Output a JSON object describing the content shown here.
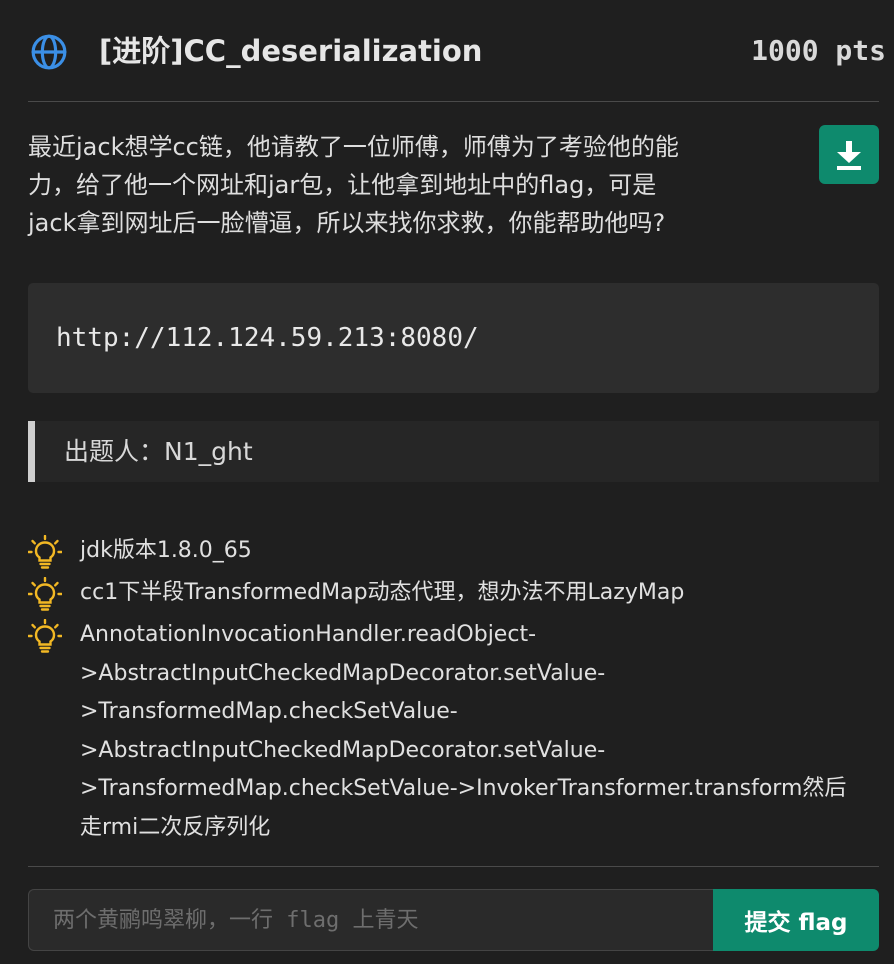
{
  "challenge": {
    "title": "[进阶]CC_deserialization",
    "points": "1000 pts",
    "description_lines": [
      "最近jack想学cc链，他请教了一位师傅，师傅为了考验他的能",
      "力，给了他一个网址和jar包，让他拿到地址中的flag，可是",
      "jack拿到网址后一脸懵逼，所以来找你求救，你能帮助他吗?"
    ],
    "url": "http://112.124.59.213:8080/",
    "author": "出题人：N1_ght"
  },
  "hints": [
    {
      "lines": [
        "jdk版本1.8.0_65"
      ]
    },
    {
      "lines": [
        "cc1下半段TransformedMap动态代理，想办法不用LazyMap"
      ]
    },
    {
      "lines": [
        "AnnotationInvocationHandler.readObject-",
        ">AbstractInputCheckedMapDecorator.setValue-",
        ">TransformedMap.checkSetValue-",
        ">AbstractInputCheckedMapDecorator.setValue-",
        ">TransformedMap.checkSetValue->InvokerTransformer.transform然后",
        "走rmi二次反序列化"
      ]
    }
  ],
  "flag_form": {
    "placeholder": "两个黄鹂鸣翠柳，一行 flag 上青天",
    "value": "",
    "submit_label": "提交 flag"
  },
  "icons": {
    "header": "globe-icon",
    "download": "download-icon",
    "hint": "lightbulb-icon"
  },
  "colors": {
    "accent": "#0e8a6d",
    "globe": "#3b8fe6",
    "hint_bulb": "#f2b824",
    "background": "#1f1f1f"
  }
}
